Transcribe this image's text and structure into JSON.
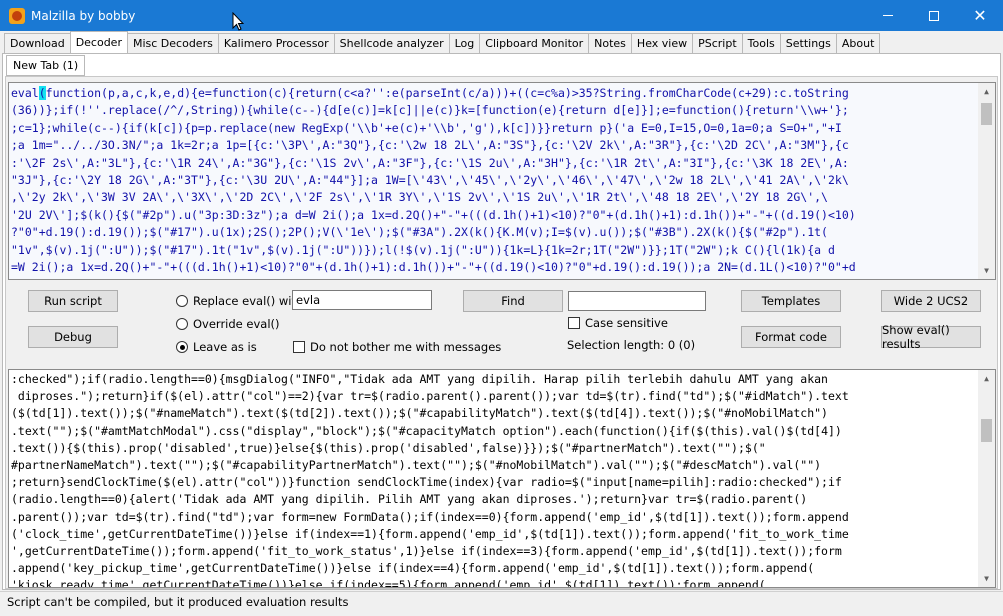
{
  "window": {
    "title": "Malzilla by bobby"
  },
  "tabs": [
    {
      "label": "Download"
    },
    {
      "label": "Decoder"
    },
    {
      "label": "Misc Decoders"
    },
    {
      "label": "Kalimero Processor"
    },
    {
      "label": "Shellcode analyzer"
    },
    {
      "label": "Log"
    },
    {
      "label": "Clipboard Monitor"
    },
    {
      "label": "Notes"
    },
    {
      "label": "Hex view"
    },
    {
      "label": "PScript"
    },
    {
      "label": "Tools"
    },
    {
      "label": "Settings"
    },
    {
      "label": "About"
    }
  ],
  "active_tab": "Decoder",
  "subtab": {
    "label": "New Tab (1)"
  },
  "code_lines": [
    [
      "eval",
      "(",
      "function(p,a,c,k,e,d){e=function(c){return(c<a?'':e(parseInt(c/a)))+((c=c%a)>35?String.fromCharCode(c+29):c.toString"
    ],
    "(36))};if(!''.replace(/^/,String)){while(c--){d[e(c)]=k[c]||e(c)}k=[function(e){return d[e]}];e=function(){return'\\\\w+'};",
    ";c=1};while(c--){if(k[c]){p=p.replace(new RegExp('\\\\b'+e(c)+'\\\\b','g'),k[c])}}return p}('a E=0,I=15,O=0,1a=0;a S=O+\",\"+I",
    ";a 1m=\"../../3O.3N/\";a 1k=2r;a 1p=[{c:'\\3P\\',A:\"3Q\"},{c:'\\2w 18 2L\\',A:\"3S\"},{c:'\\2V 2k\\',A:\"3R\"},{c:'\\2D 2C\\',A:\"3M\"},{c",
    ":'\\2F 2s\\',A:\"3L\"},{c:'\\1R 24\\',A:\"3G\"},{c:'\\1S 2v\\',A:\"3F\"},{c:'\\1S 2u\\',A:\"3H\"},{c:'\\1R 2t\\',A:\"3I\"},{c:'\\3K 18 2E\\',A:",
    "\"3J\"},{c:'\\2Y 18 2G\\',A:\"3T\"},{c:'\\3U 2U\\',A:\"44\"}];a 1W=[\\'43\\',\\'45\\',\\'2y\\',\\'46\\',\\'47\\',\\'2w 18 2L\\',\\'41 2A\\',\\'2k\\",
    ",\\'2y 2k\\',\\'3W 3V 2A\\',\\'3X\\',\\'2D 2C\\',\\'2F 2s\\',\\'1R 3Y\\',\\'1S 2v\\',\\'1S 2u\\',\\'1R 2t\\',\\'48 18 2E\\',\\'2Y 18 2G\\',\\",
    "'2U 2V\\'];$(k(){$(\"#2p\").u(\"3p:3D:3z\");a d=W 2i();a 1x=d.2Q()+\"-\"+(((d.1h()+1)<10)?\"0\"+(d.1h()+1):d.1h())+\"-\"+((d.19()<10)",
    "?\"0\"+d.19():d.19());$(\"#17\").u(1x);2S();2P();V(\\'1e\\');$(\"#3A\").2X(k(){K.M(v);I=$(v).u());$(\"#3B\").2X(k(){$(\"#2p\").1t(",
    "\"1v\",$(v).1j(\":U\"));$(\"#17\").1t(\"1v\",$(v).1j(\":U\"))});l(!$(v).1j(\":U\")){1k=L}{1k=2r;1T(\"2W\")}};1T(\"2W\");k C(){l(1k){a d",
    "=W 2i();a 1x=d.2Q()+\"-\"+(((d.1h()+1)<10)?\"0\"+(d.1h()+1):d.1h())+\"-\"+((d.19()<10)?\"0\"+d.19():d.19());a 2N=(d.1L()<10)?\"0\"+d",
    ".1L():d.1L()+\":\"+(((d.1J()<10)?\"0\"+d.1J():d.1J())+\":\"+(d.1K()<10?\"0\"+d.1K():d.1K();J(1x+\" \"+2N);a d=\"#17\";a i=$(\"#2p\""
  ],
  "controls": {
    "run_script": "Run script",
    "debug": "Debug",
    "replace_eval_label": "Replace eval() with",
    "replace_eval_value": "evla",
    "override_eval_label": "Override eval()",
    "leave_as_is_label": "Leave as is",
    "no_bother_label": "Do not bother me with messages",
    "find": "Find",
    "find_value": "",
    "case_sensitive_label": "Case sensitive",
    "selection_length": "Selection length: 0 (0)",
    "templates": "Templates",
    "format_code": "Format code",
    "wide_2_ucs2": "Wide 2 UCS2",
    "show_eval_results": "Show eval() results",
    "selected_radio": "leave"
  },
  "output_lines": [
    ":checked\");if(radio.length==0){msgDialog(\"INFO\",\"Tidak ada AMT yang dipilih. Harap pilih terlebih dahulu AMT yang akan",
    " diproses.\");return}if($(el).attr(\"col\")==2){var tr=$(radio.parent().parent());var td=$(tr).find(\"td\");$(\"#idMatch\").text",
    "($(td[1]).text());$(\"#nameMatch\").text($(td[2]).text());$(\"#capabilityMatch\").text($(td[4]).text());$(\"#noMobilMatch\")",
    ".text(\"\");$(\"#amtMatchModal\").css(\"display\",\"block\");$(\"#capacityMatch option\").each(function(){if($(this).val()",
    "$(td[4])",
    ".text()){$(this).prop('disabled',true)}else{$(this).prop('disabled',false)}});$(\"#partnerMatch\").text(\"\");$(\"",
    "#partnerNameMatch\").text(\"\");$(\"#capabilityPartnerMatch\").text(\"\");$(\"#noMobilMatch\").val(\"\");$(\"#descMatch\").val(\"\")",
    ";return}sendClockTime($(el).attr(\"col\"))}function sendClockTime(index){var radio=$(\"input[name=pilih]:radio:checked\");if",
    "(radio.length==0){alert('Tidak ada AMT yang dipilih. Pilih AMT yang akan diproses.');return}var tr=$(radio.parent()",
    ".parent());var td=$(tr).find(\"td\");var form=new FormData();if(index==0){form.append('emp_id',$(td[1]).text());form.append",
    "('clock_time',getCurrentDateTime())}else if(index==1){form.append('emp_id',$(td[1]).text());form.append('fit_to_work_time",
    "',getCurrentDateTime());form.append('fit_to_work_status',1)}else if(index==3){form.append('emp_id',$(td[1]).text());form",
    ".append('key_pickup_time',getCurrentDateTime())}else if(index==4){form.append('emp_id',$(td[1]).text());form.append(",
    "'kiosk_ready_time',getCurrentDateTime())}else if(index==5){form.append('emp_id',$(td[1]).text());form.append("
  ],
  "status": "Script can't be compiled, but it produced evaluation results",
  "colors": {
    "titlebar": "#1a79d4",
    "code_text": "#1111aa",
    "highlight": "#13e0f0"
  },
  "icons": {
    "app": "malzilla-app-icon"
  }
}
